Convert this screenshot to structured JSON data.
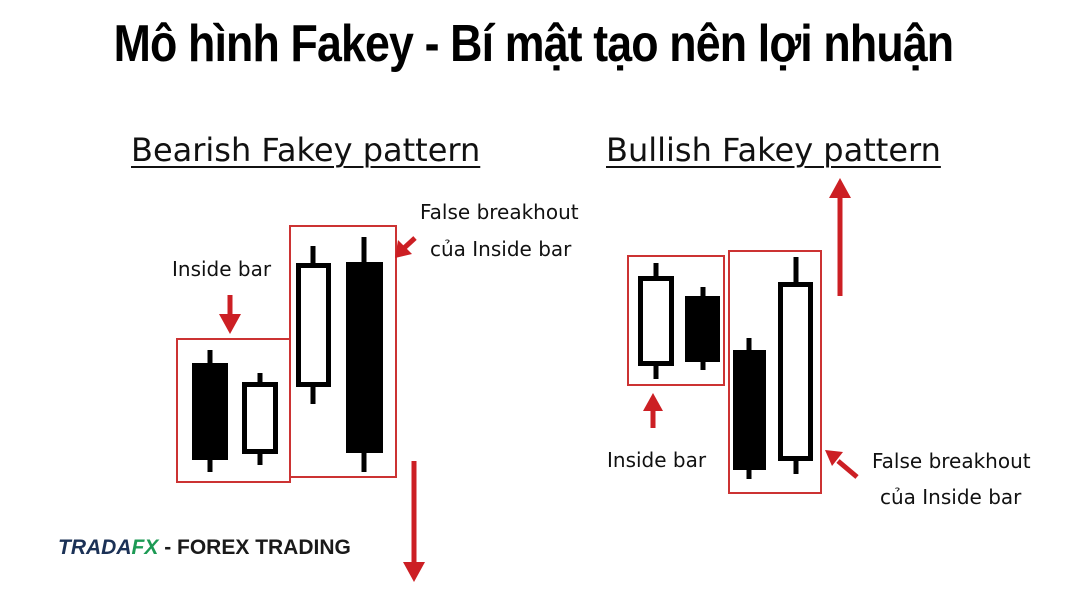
{
  "title": "Mô hình Fakey - Bí mật tạo nên lợi nhuận",
  "bearish": {
    "heading": "Bearish Fakey pattern",
    "inside_bar_label": "Inside bar",
    "false_breakout_line1": "False breakhout",
    "false_breakout_line2": "của Inside bar"
  },
  "bullish": {
    "heading": "Bullish Fakey pattern",
    "inside_bar_label": "Inside bar",
    "false_breakout_line1": "False breakhout",
    "false_breakout_line2": "của Inside bar"
  },
  "brand": {
    "part1": "TRADA",
    "part2": "FX",
    "part3": "- FOREX TRADING"
  },
  "colors": {
    "box": "#cc3333",
    "arrow": "#cc1f24",
    "candle": "#000000"
  }
}
